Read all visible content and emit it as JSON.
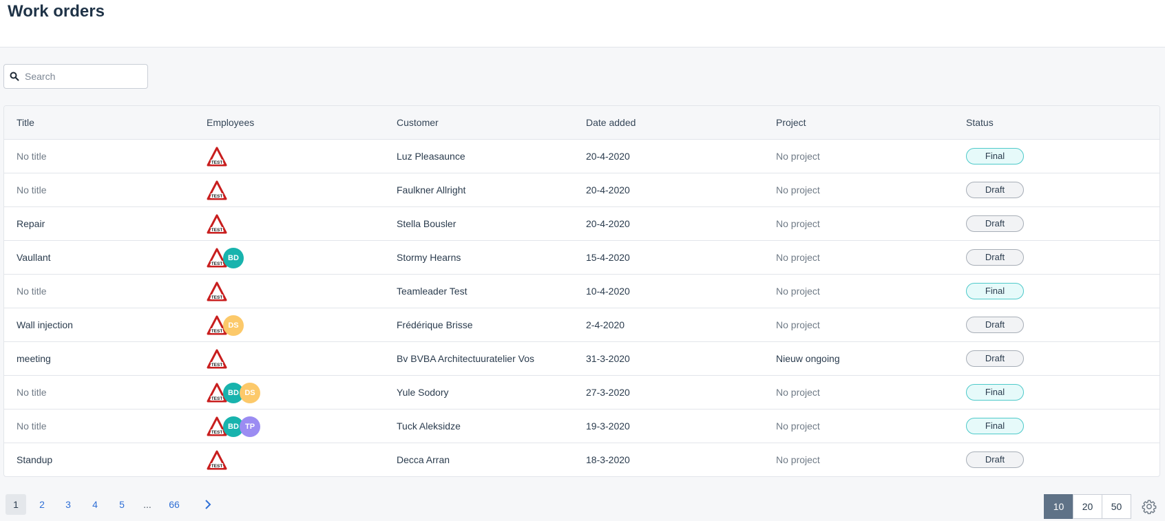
{
  "header": {
    "title": "Work orders"
  },
  "search": {
    "placeholder": "Search",
    "value": ""
  },
  "table": {
    "columns": [
      "Title",
      "Employees",
      "Customer",
      "Date added",
      "Project",
      "Status"
    ],
    "rows": [
      {
        "title": "No title",
        "title_muted": true,
        "employees": [],
        "customer": "Luz Pleasaunce",
        "date": "20-4-2020",
        "project": "No project",
        "project_muted": true,
        "status": "Final"
      },
      {
        "title": "No title",
        "title_muted": true,
        "employees": [],
        "customer": "Faulkner Allright",
        "date": "20-4-2020",
        "project": "No project",
        "project_muted": true,
        "status": "Draft"
      },
      {
        "title": "Repair",
        "title_muted": false,
        "employees": [],
        "customer": "Stella Bousler",
        "date": "20-4-2020",
        "project": "No project",
        "project_muted": true,
        "status": "Draft"
      },
      {
        "title": "Vaullant",
        "title_muted": false,
        "employees": [
          "BD"
        ],
        "customer": "Stormy Hearns",
        "date": "15-4-2020",
        "project": "No project",
        "project_muted": true,
        "status": "Draft"
      },
      {
        "title": "No title",
        "title_muted": true,
        "employees": [],
        "customer": "Teamleader Test",
        "date": "10-4-2020",
        "project": "No project",
        "project_muted": true,
        "status": "Final"
      },
      {
        "title": "Wall injection",
        "title_muted": false,
        "employees": [
          "DS"
        ],
        "customer": "Frédérique Brisse",
        "date": "2-4-2020",
        "project": "No project",
        "project_muted": true,
        "status": "Draft"
      },
      {
        "title": "meeting",
        "title_muted": false,
        "employees": [],
        "customer": "Bv BVBA Architectuuratelier Vos",
        "date": "31-3-2020",
        "project": "Nieuw ongoing",
        "project_muted": false,
        "status": "Draft"
      },
      {
        "title": "No title",
        "title_muted": true,
        "employees": [
          "BD",
          "DS"
        ],
        "customer": "Yule Sodory",
        "date": "27-3-2020",
        "project": "No project",
        "project_muted": true,
        "status": "Final"
      },
      {
        "title": "No title",
        "title_muted": true,
        "employees": [
          "BD",
          "TP"
        ],
        "customer": "Tuck Aleksidze",
        "date": "19-3-2020",
        "project": "No project",
        "project_muted": true,
        "status": "Final"
      },
      {
        "title": "Standup",
        "title_muted": false,
        "employees": [],
        "customer": "Decca Arran",
        "date": "18-3-2020",
        "project": "No project",
        "project_muted": true,
        "status": "Draft"
      }
    ]
  },
  "employee_avatar": {
    "icon": "warning-triangle-icon",
    "label": "TEST"
  },
  "avatar_colors": {
    "BD": "#18b3ad",
    "DS": "#fcc96a",
    "TP": "#9b8cf2"
  },
  "pagination": {
    "current": "1",
    "pages": [
      "1",
      "2",
      "3",
      "4",
      "5",
      "...",
      "66"
    ],
    "next_icon": "chevron-right-icon"
  },
  "page_sizes": {
    "options": [
      "10",
      "20",
      "50"
    ],
    "selected": "10"
  },
  "settings_icon": "gear-icon"
}
